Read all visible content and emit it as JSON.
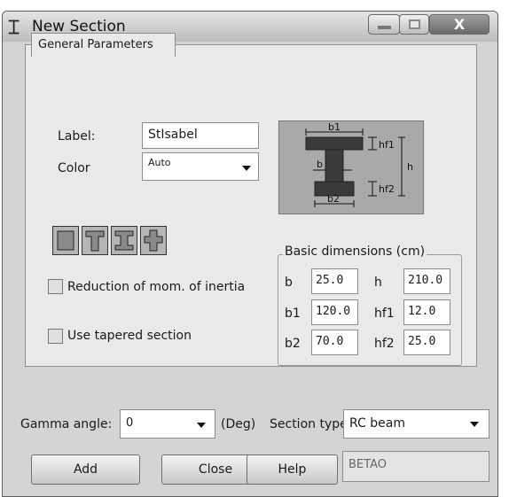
{
  "window": {
    "title": "New Section",
    "app_icon": "I-beam-section-icon",
    "controls": {
      "minimize": "minimize-icon",
      "maximize": "maximize-icon",
      "close_label": "X"
    }
  },
  "tabs": [
    {
      "label": "General Parameters",
      "active": true
    }
  ],
  "form": {
    "label_caption": "Label:",
    "label_value": "StIsabel",
    "color_caption": "Color",
    "color_value": "Auto"
  },
  "diagram": {
    "b1": "b1",
    "b": "b",
    "b2": "b2",
    "hf1": "hf1",
    "hf2": "hf2",
    "h": "h"
  },
  "shape_buttons": [
    "rectangular-section-icon",
    "T-section-icon",
    "I-section-icon",
    "cross-section-icon"
  ],
  "options": {
    "reduction_label": "Reduction of mom. of inertia",
    "reduction_checked": false,
    "tapered_label": "Use tapered section",
    "tapered_checked": false
  },
  "dimensions": {
    "title": "Basic dimensions (cm)",
    "rows": [
      {
        "l1": "b",
        "v1": "25.0",
        "l2": "h",
        "v2": "210.0"
      },
      {
        "l1": "b1",
        "v1": "120.0",
        "l2": "hf1",
        "v2": "12.0"
      },
      {
        "l1": "b2",
        "v1": "70.0",
        "l2": "hf2",
        "v2": "25.0"
      }
    ]
  },
  "bottom": {
    "gamma_label": "Gamma angle:",
    "gamma_value": "0",
    "gamma_unit": "(Deg)",
    "section_type_label": "Section type:",
    "section_type_value": "RC beam",
    "buttons": {
      "add": "Add",
      "close": "Close",
      "help": "Help"
    },
    "name_field": "BETAO"
  }
}
